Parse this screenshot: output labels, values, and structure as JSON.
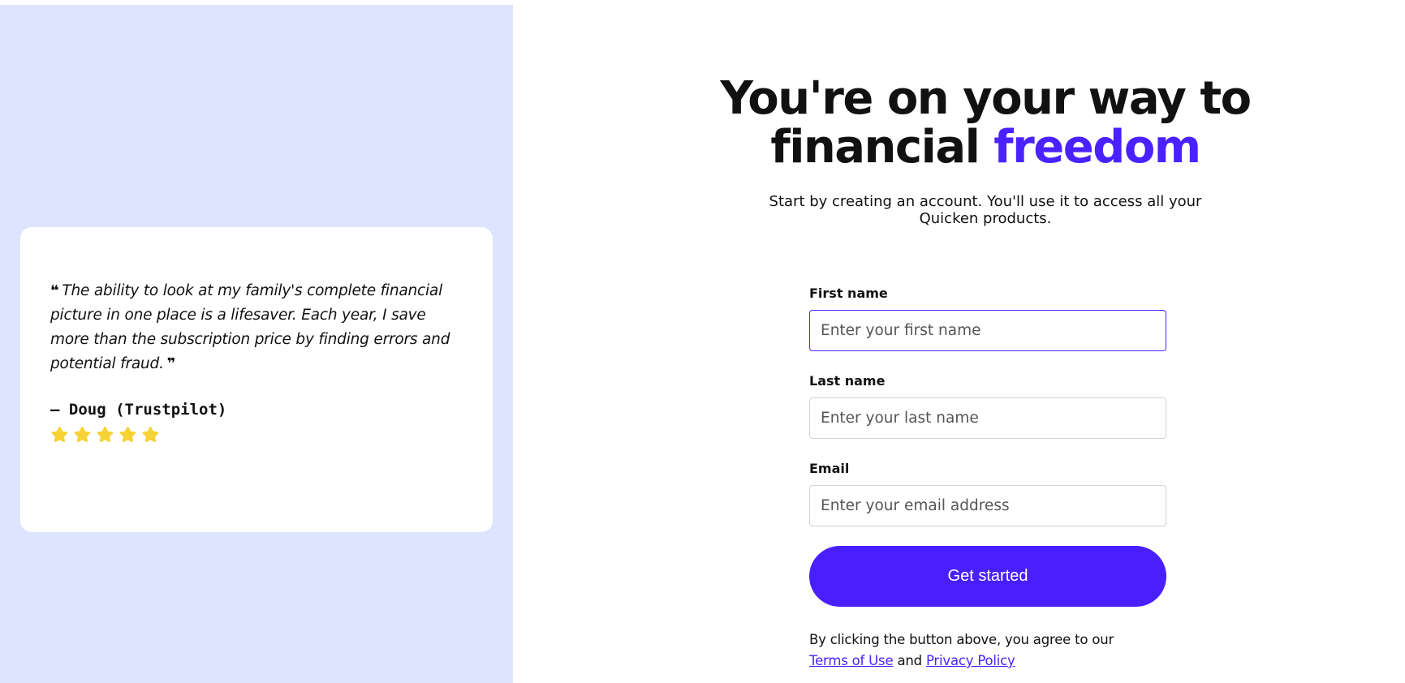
{
  "review": {
    "open_quote": "❝",
    "text": "The ability to look at my family's complete financial picture in one place is a lifesaver. Each year, I save more than the subscription price by finding errors and potential fraud.",
    "close_quote": "❞",
    "author": "— Doug (Trustpilot)",
    "rating": 5,
    "star_color": "#f7d235"
  },
  "hero": {
    "title_line1": "You're on your way to",
    "title_line2_prefix": "financial ",
    "title_accent": "freedom",
    "subtitle_line1": "Start by creating an account. You'll use it to access all your",
    "subtitle_line2": "Quicken products."
  },
  "form": {
    "first_name": {
      "label": "First name",
      "placeholder": "Enter your first name",
      "value": ""
    },
    "last_name": {
      "label": "Last name",
      "placeholder": "Enter your last name",
      "value": ""
    },
    "email": {
      "label": "Email",
      "placeholder": "Enter your email address",
      "value": ""
    },
    "submit_label": "Get started"
  },
  "legal": {
    "prefix": "By clicking the button above, you agree to our",
    "terms_label": "Terms of Use",
    "and_label": "and",
    "privacy_label": "Privacy Policy"
  },
  "colors": {
    "accent": "#4a22ff",
    "left_panel_bg": "#dce4fe"
  }
}
